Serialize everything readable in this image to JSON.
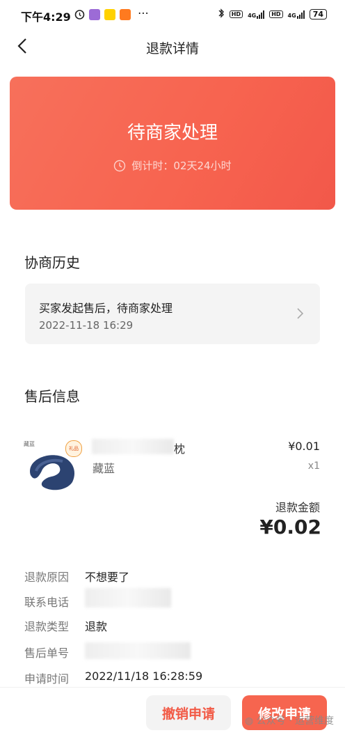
{
  "status_bar": {
    "time": "下午4:29",
    "signal_1": "4G",
    "signal_2": "4G",
    "hd": "HD",
    "battery": "74"
  },
  "nav": {
    "title": "退款详情"
  },
  "hero": {
    "status": "待商家处理",
    "countdown": "倒计时：02天24小时"
  },
  "history": {
    "section_title": "协商历史",
    "entry_title": "买家发起售后，待商家处理",
    "entry_time": "2022-11-18 16:29"
  },
  "after_sale": {
    "section_title": "售后信息",
    "product": {
      "name_visible_suffix": "枕",
      "variant": "藏蓝",
      "price": "¥0.01",
      "quantity": "x1",
      "thumb_label": "藏蓝",
      "thumb_badge": "礼品"
    },
    "refund_label": "退款金额",
    "refund_amount": "¥0.02",
    "details": [
      {
        "label": "退款原因",
        "value": "不想要了"
      },
      {
        "label": "联系电话",
        "value": ""
      },
      {
        "label": "退款类型",
        "value": "退款"
      },
      {
        "label": "售后单号",
        "value": ""
      },
      {
        "label": "申请时间",
        "value": "2022/11/18 16:28:59"
      }
    ]
  },
  "actions": {
    "cancel": "撤销申请",
    "modify": "修改申请"
  },
  "watermark": "公众号 · 运营维度",
  "colors": {
    "accent": "#f6654f",
    "card_bg": "#f4f4f4"
  }
}
